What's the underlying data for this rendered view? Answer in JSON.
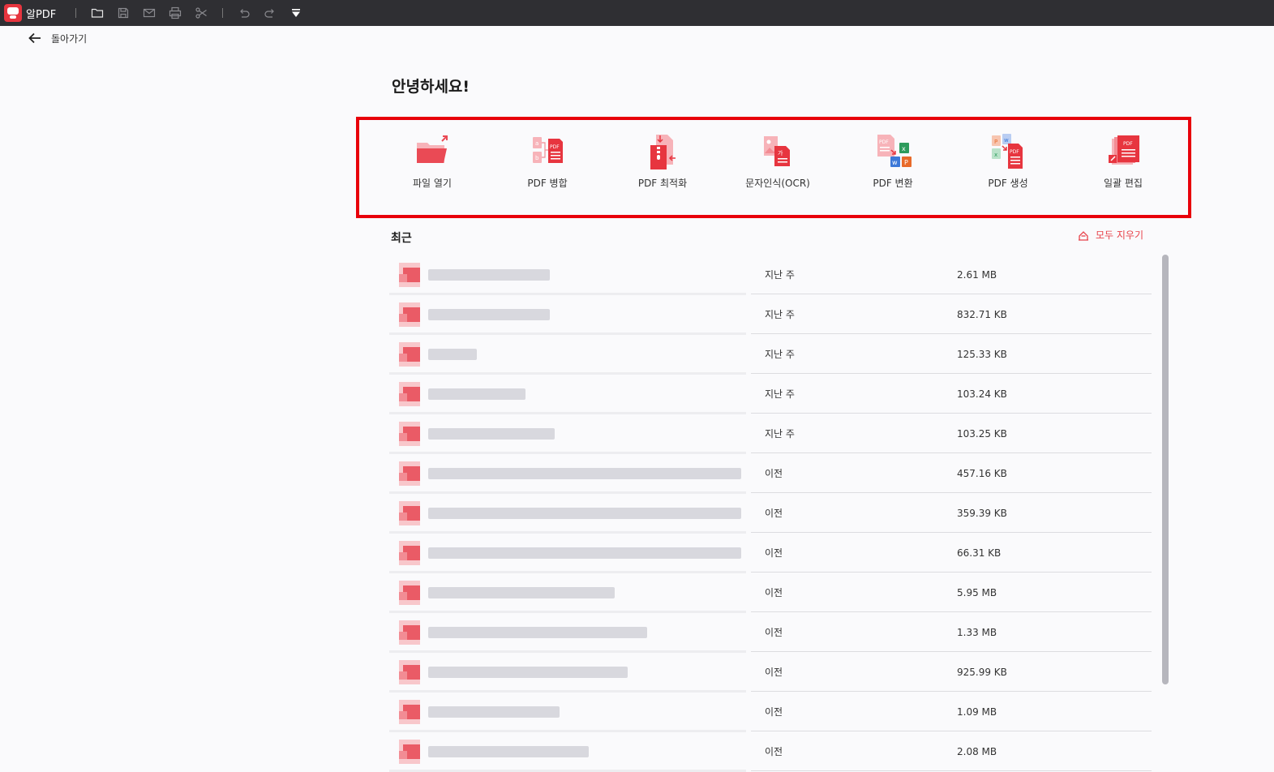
{
  "app": {
    "name": "알PDF"
  },
  "toolbar": {
    "icons": [
      "folder-icon",
      "save-icon",
      "mail-icon",
      "print-icon",
      "scissors-icon",
      "undo-icon",
      "redo-icon",
      "dropdown-icon"
    ]
  },
  "nav": {
    "back_label": "돌아가기"
  },
  "greeting": "안녕하세요!",
  "tools": [
    {
      "label": "파일 열기",
      "icon": "open-file-icon"
    },
    {
      "label": "PDF 병합",
      "icon": "merge-pdf-icon"
    },
    {
      "label": "PDF 최적화",
      "icon": "optimize-pdf-icon"
    },
    {
      "label": "문자인식(OCR)",
      "icon": "ocr-icon"
    },
    {
      "label": "PDF 변환",
      "icon": "convert-pdf-icon"
    },
    {
      "label": "PDF 생성",
      "icon": "create-pdf-icon"
    },
    {
      "label": "일괄 편집",
      "icon": "batch-edit-icon"
    }
  ],
  "recent": {
    "title": "최근",
    "clear_all_label": "모두 지우기",
    "items": [
      {
        "when": "지난 주",
        "size": "2.61 MB"
      },
      {
        "when": "지난 주",
        "size": "832.71 KB"
      },
      {
        "when": "지난 주",
        "size": "125.33 KB"
      },
      {
        "when": "지난 주",
        "size": "103.24 KB"
      },
      {
        "when": "지난 주",
        "size": "103.25 KB"
      },
      {
        "when": "이전",
        "size": "457.16 KB"
      },
      {
        "when": "이전",
        "size": "359.39 KB"
      },
      {
        "when": "이전",
        "size": "66.31 KB"
      },
      {
        "when": "이전",
        "size": "5.95 MB"
      },
      {
        "when": "이전",
        "size": "1.33 MB"
      },
      {
        "when": "이전",
        "size": "925.99 KB"
      },
      {
        "when": "이전",
        "size": "1.09 MB"
      },
      {
        "when": "이전",
        "size": "2.08 MB"
      }
    ]
  },
  "colors": {
    "accent": "#e8424a",
    "highlight_border": "#e8000b",
    "titlebar": "#2f2f33"
  }
}
